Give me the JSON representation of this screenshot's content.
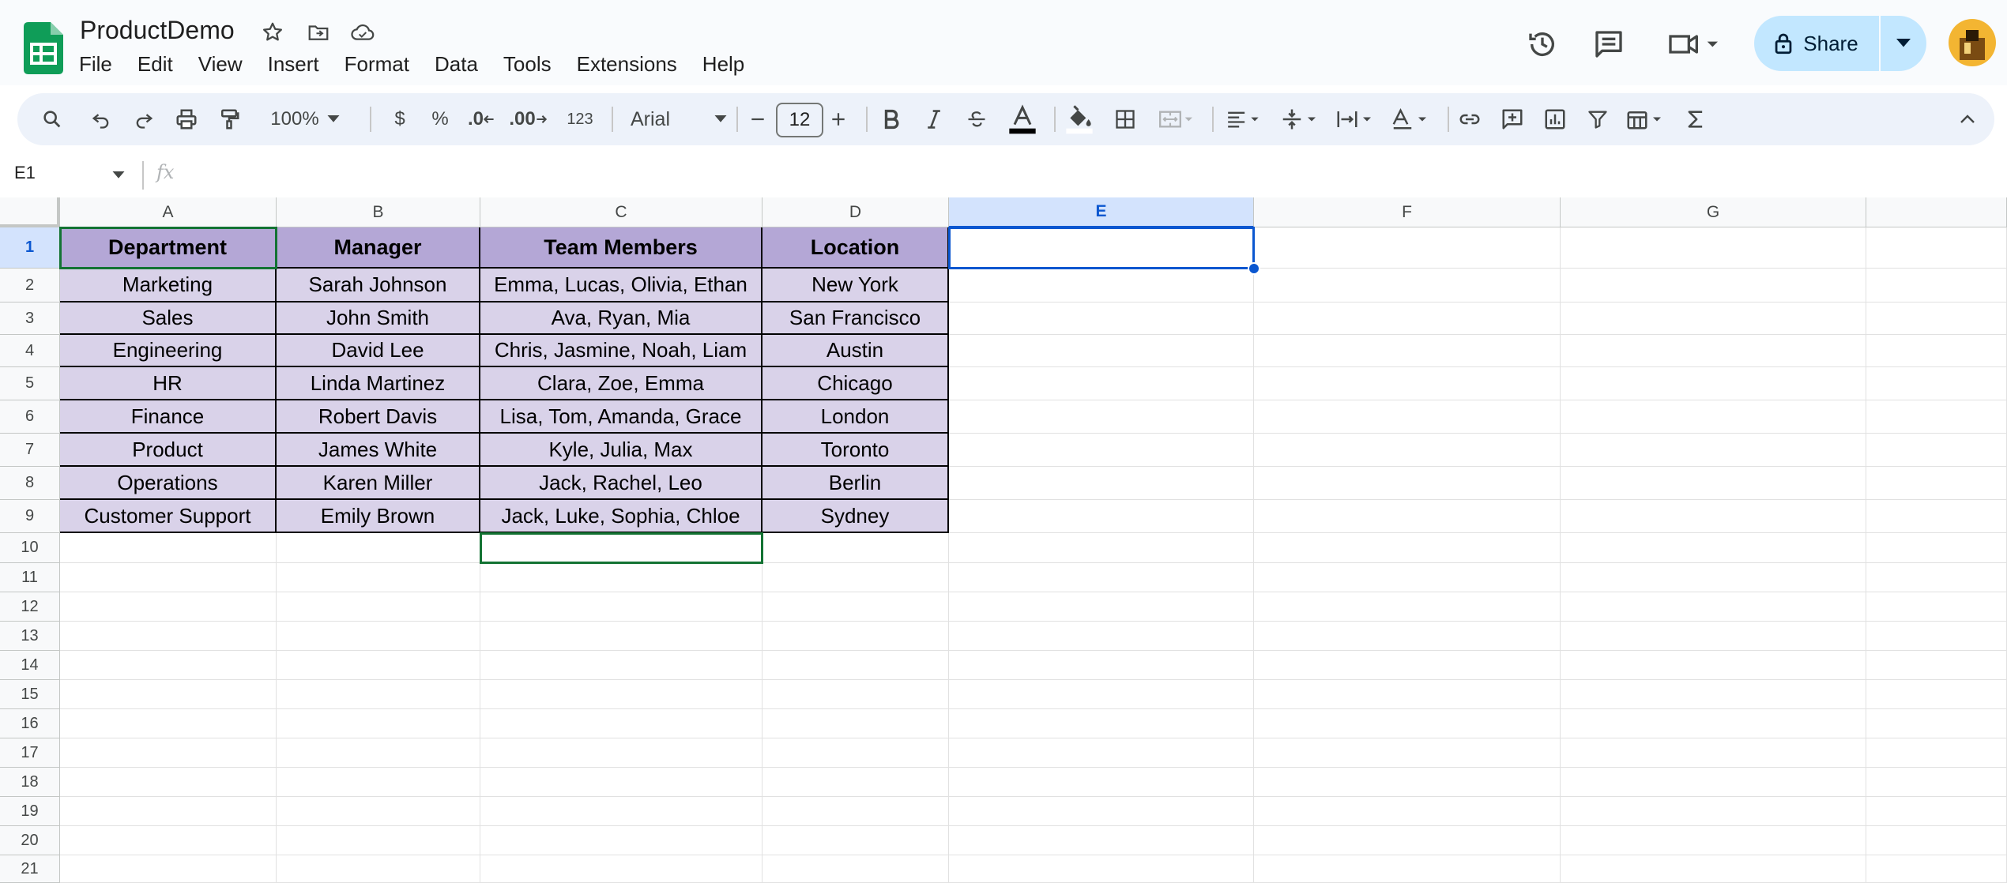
{
  "app": {
    "title": "ProductDemo",
    "menu": [
      "File",
      "Edit",
      "View",
      "Insert",
      "Format",
      "Data",
      "Tools",
      "Extensions",
      "Help"
    ],
    "share_label": "Share"
  },
  "toolbar": {
    "zoom": "100%",
    "currency": "$",
    "percent": "%",
    "decrease_decimal": ".0",
    "increase_decimal": ".00",
    "more_formats": "123",
    "font": "Arial",
    "font_size": "12"
  },
  "formula_bar": {
    "name_box": "E1",
    "fx_label": "fx",
    "content": ""
  },
  "sheet": {
    "columns": [
      "A",
      "B",
      "C",
      "D",
      "E",
      "F",
      "G"
    ],
    "selected_column": "E",
    "rows": [
      "1",
      "2",
      "3",
      "4",
      "5",
      "6",
      "7",
      "8",
      "9",
      "10",
      "11",
      "12",
      "13",
      "14",
      "15",
      "16",
      "17",
      "18",
      "19",
      "20",
      "21"
    ],
    "selected_row": "1",
    "header": [
      "Department",
      "Manager",
      "Team Members",
      "Location"
    ],
    "data": [
      [
        "Marketing",
        "Sarah Johnson",
        "Emma, Lucas, Olivia, Ethan",
        "New York"
      ],
      [
        "Sales",
        "John Smith",
        "Ava, Ryan, Mia",
        "San Francisco"
      ],
      [
        "Engineering",
        "David Lee",
        "Chris, Jasmine, Noah, Liam",
        "Austin"
      ],
      [
        "HR",
        "Linda Martinez",
        "Clara, Zoe, Emma",
        "Chicago"
      ],
      [
        "Finance",
        "Robert Davis",
        "Lisa, Tom, Amanda, Grace",
        "London"
      ],
      [
        "Product",
        "James White",
        "Kyle, Julia, Max",
        "Toronto"
      ],
      [
        "Operations",
        "Karen Miller",
        "Jack, Rachel, Leo",
        "Berlin"
      ],
      [
        "Customer Support",
        "Emily Brown",
        "Jack, Luke, Sophia, Chloe",
        "Sydney"
      ]
    ]
  },
  "colors": {
    "header_fill": "#b4a7d6",
    "data_fill": "#d9d2e9",
    "selection": "#0b57d0",
    "share_bg": "#c2e7ff"
  }
}
